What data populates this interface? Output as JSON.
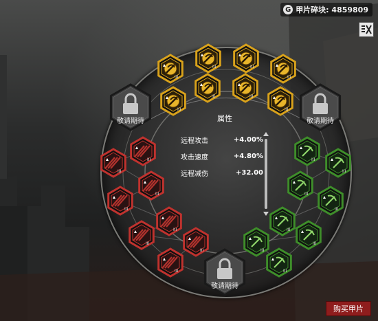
{
  "currency": {
    "label": "甲片碎块: 4859809",
    "icon": "currency-g-icon",
    "coin_glyph": "G"
  },
  "close_button": {
    "icon": "close-icon"
  },
  "attributes": {
    "title": "属性",
    "rows": [
      {
        "name": "远程攻击",
        "value": "+4.00%"
      },
      {
        "name": "攻击速度",
        "value": "+4.80%"
      },
      {
        "name": "远程减伤",
        "value": "+32.00"
      }
    ]
  },
  "locked_slots": [
    {
      "label": "敬请期待",
      "icon": "lock-icon"
    },
    {
      "label": "敬请期待",
      "icon": "lock-icon"
    },
    {
      "label": "敬请期待",
      "icon": "lock-icon"
    }
  ],
  "buy_button": {
    "label": "购买甲片"
  },
  "node_level_mark": "III",
  "colors": {
    "gold": "#d9a21b",
    "red": "#c0322e",
    "green": "#3e8e2a",
    "buy": "#8f1d1d"
  }
}
